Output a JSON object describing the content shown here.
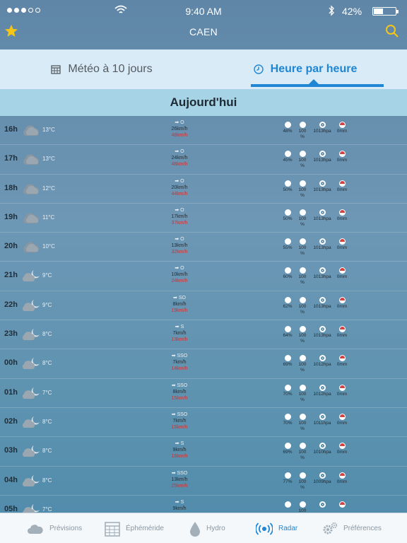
{
  "status": {
    "time": "9:40 AM",
    "battery": "42%"
  },
  "nav": {
    "title": "CAEN"
  },
  "tabs": {
    "forecast_10": "Météo à 10 jours",
    "hourly": "Heure par heure"
  },
  "day_header": "Aujourd'hui",
  "rows": [
    {
      "hour": "16h",
      "temp": "13°C",
      "dir": "O",
      "speed": "26km/h",
      "gust": "48km/h",
      "hum": "48%",
      "cloud": "100",
      "press": "1013hpa",
      "rain": "0mm",
      "icon": "cloud-icon"
    },
    {
      "hour": "17h",
      "temp": "13°C",
      "dir": "O",
      "speed": "24km/h",
      "gust": "48km/h",
      "hum": "45%",
      "cloud": "100",
      "press": "1013hpa",
      "rain": "0mm",
      "icon": "cloud-icon"
    },
    {
      "hour": "18h",
      "temp": "12°C",
      "dir": "O",
      "speed": "20km/h",
      "gust": "44km/h",
      "hum": "50%",
      "cloud": "100",
      "press": "1013hpa",
      "rain": "0mm",
      "icon": "cloud-icon"
    },
    {
      "hour": "19h",
      "temp": "11°C",
      "dir": "O",
      "speed": "17km/h",
      "gust": "37km/h",
      "hum": "50%",
      "cloud": "100",
      "press": "1013hpa",
      "rain": "0mm",
      "icon": "cloud-icon"
    },
    {
      "hour": "20h",
      "temp": "10°C",
      "dir": "O",
      "speed": "13km/h",
      "gust": "32km/h",
      "hum": "55%",
      "cloud": "100",
      "press": "1013hpa",
      "rain": "0mm",
      "icon": "cloud-icon"
    },
    {
      "hour": "21h",
      "temp": "9°C",
      "dir": "O",
      "speed": "10km/h",
      "gust": "24km/h",
      "hum": "60%",
      "cloud": "100",
      "press": "1013hpa",
      "rain": "0mm",
      "icon": "cloud-moon-icon"
    },
    {
      "hour": "22h",
      "temp": "9°C",
      "dir": "SO",
      "speed": "8km/h",
      "gust": "19km/h",
      "hum": "62%",
      "cloud": "100",
      "press": "1013hpa",
      "rain": "0mm",
      "icon": "cloud-moon-icon"
    },
    {
      "hour": "23h",
      "temp": "8°C",
      "dir": "S",
      "speed": "7km/h",
      "gust": "13km/h",
      "hum": "64%",
      "cloud": "100",
      "press": "1013hpa",
      "rain": "0mm",
      "icon": "cloud-moon-icon"
    },
    {
      "hour": "00h",
      "temp": "8°C",
      "dir": "SSO",
      "speed": "7km/h",
      "gust": "14km/h",
      "hum": "69%",
      "cloud": "100",
      "press": "1012hpa",
      "rain": "0mm",
      "icon": "cloud-moon-icon"
    },
    {
      "hour": "01h",
      "temp": "7°C",
      "dir": "SSO",
      "speed": "8km/h",
      "gust": "15km/h",
      "hum": "70%",
      "cloud": "100",
      "press": "1012hpa",
      "rain": "0mm",
      "icon": "cloud-moon-icon"
    },
    {
      "hour": "02h",
      "temp": "8°C",
      "dir": "SSO",
      "speed": "7km/h",
      "gust": "15km/h",
      "hum": "70%",
      "cloud": "100",
      "press": "1011hpa",
      "rain": "0mm",
      "icon": "cloud-moon-icon"
    },
    {
      "hour": "03h",
      "temp": "8°C",
      "dir": "S",
      "speed": "9km/h",
      "gust": "16km/h",
      "hum": "69%",
      "cloud": "100",
      "press": "1010hpa",
      "rain": "0mm",
      "icon": "cloud-moon-icon"
    },
    {
      "hour": "04h",
      "temp": "8°C",
      "dir": "SSO",
      "speed": "13km/h",
      "gust": "25km/h",
      "hum": "77%",
      "cloud": "100",
      "press": "1009hpa",
      "rain": "0mm",
      "icon": "cloud-moon-icon"
    },
    {
      "hour": "05h",
      "temp": "7°C",
      "dir": "S",
      "speed": "9km/h",
      "gust": "",
      "hum": "",
      "cloud": "100",
      "press": "",
      "rain": "",
      "icon": "cloud-moon-icon"
    }
  ],
  "tabbar": {
    "previsions": "Prévisions",
    "ephemeride": "Éphéméride",
    "hydro": "Hydro",
    "radar": "Radar",
    "preferences": "Préférences"
  },
  "colors": {
    "accent": "#1f86d4",
    "star": "#f5c518",
    "gust": "#cc3333"
  }
}
